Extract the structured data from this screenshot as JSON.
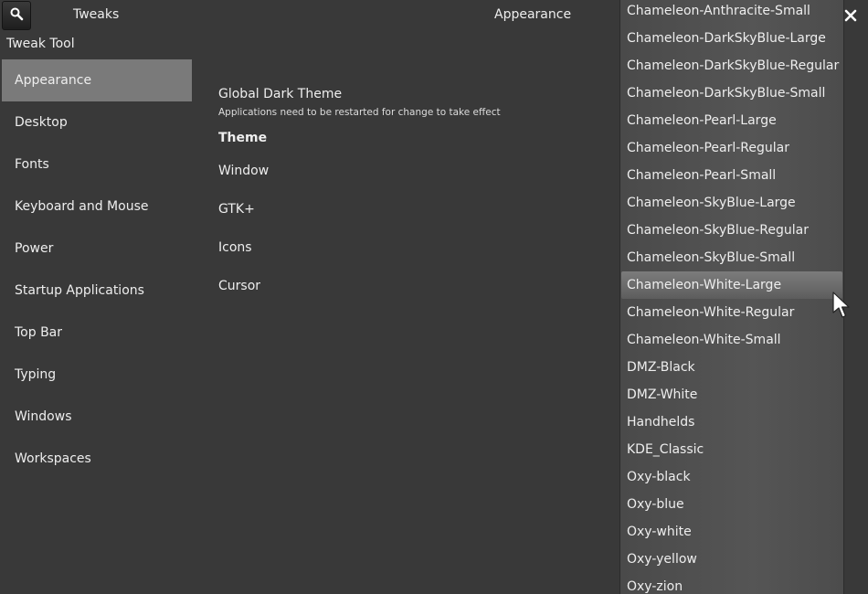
{
  "header": {
    "title": "Tweaks",
    "section": "Appearance",
    "search_icon": "search-icon",
    "close_icon": "close-icon"
  },
  "app_name": "Tweak Tool",
  "sidebar": {
    "items": [
      {
        "label": "Appearance",
        "active": true
      },
      {
        "label": "Desktop"
      },
      {
        "label": "Fonts"
      },
      {
        "label": "Keyboard and Mouse"
      },
      {
        "label": "Power"
      },
      {
        "label": "Startup Applications"
      },
      {
        "label": "Top Bar"
      },
      {
        "label": "Typing"
      },
      {
        "label": "Windows"
      },
      {
        "label": "Workspaces"
      }
    ]
  },
  "content": {
    "global_dark_theme": "Global Dark Theme",
    "restart_note": "Applications need to be restarted for change to take effect",
    "theme_heading": "Theme",
    "window_label": "Window",
    "gtk_label": "GTK+",
    "icons_label": "Icons",
    "cursor_label": "Cursor"
  },
  "dropdown": {
    "selected": "Chameleon-White-Large",
    "options": [
      "Chameleon-Anthracite-Small",
      "Chameleon-DarkSkyBlue-Large",
      "Chameleon-DarkSkyBlue-Regular",
      "Chameleon-DarkSkyBlue-Small",
      "Chameleon-Pearl-Large",
      "Chameleon-Pearl-Regular",
      "Chameleon-Pearl-Small",
      "Chameleon-SkyBlue-Large",
      "Chameleon-SkyBlue-Regular",
      "Chameleon-SkyBlue-Small",
      "Chameleon-White-Large",
      "Chameleon-White-Regular",
      "Chameleon-White-Small",
      "DMZ-Black",
      "DMZ-White",
      "Handhelds",
      "KDE_Classic",
      "Oxy-black",
      "Oxy-blue",
      "Oxy-white",
      "Oxy-yellow",
      "Oxy-zion"
    ]
  },
  "colors": {
    "background": "#393939",
    "sidebar_active": "#7a7a7a",
    "text": "#eeeeee",
    "dropdown_bg": "#555555"
  }
}
